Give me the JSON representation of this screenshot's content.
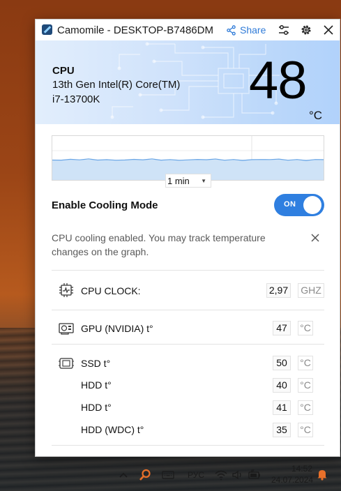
{
  "window": {
    "title": "Camomile - DESKTOP-B7486DM",
    "share_label": "Share"
  },
  "hero": {
    "label": "CPU",
    "name": "13th Gen Intel(R) Core(TM) i7-13700K",
    "temperature": "48",
    "unit": "°C"
  },
  "graph": {
    "range": "1 min",
    "temperature_level": 0.45
  },
  "cooling": {
    "label": "Enable Cooling Mode",
    "toggle_text": "ON",
    "enabled": true,
    "notice": "CPU cooling enabled. You may track temperature changes on the graph."
  },
  "sensors": {
    "cpu_clock": {
      "label": "CPU CLOCK:",
      "value": "2,97",
      "unit": "GHZ"
    },
    "gpu": {
      "label": "GPU (NVIDIA) t°",
      "value": "47",
      "unit": "°C"
    },
    "ssd": {
      "label": "SSD t°",
      "value": "50",
      "unit": "°C"
    },
    "hdd1": {
      "label": "HDD t°",
      "value": "40",
      "unit": "°C"
    },
    "hdd2": {
      "label": "HDD t°",
      "value": "41",
      "unit": "°C"
    },
    "hdd_wdc": {
      "label": "HDD (WDC) t°",
      "value": "35",
      "unit": "°C"
    }
  },
  "taskbar": {
    "language": "РУС",
    "time": "14:52",
    "date": "24.07.2024"
  },
  "colors": {
    "accent": "#2f7fe0",
    "hero_bg": "#cfe2fb",
    "notification": "#e8702a"
  }
}
